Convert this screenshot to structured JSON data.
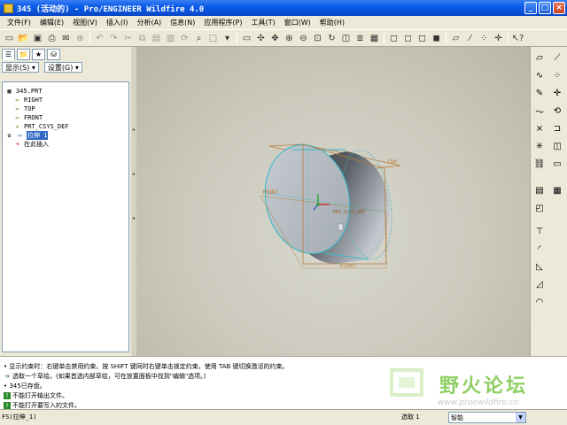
{
  "window": {
    "title": "345 (活动的) - Pro/ENGINEER Wildfire 4.0",
    "minimize": "_",
    "maximize": "□",
    "close": "×"
  },
  "menu": [
    "文件(F)",
    "编辑(E)",
    "视图(V)",
    "插入(I)",
    "分析(A)",
    "信息(N)",
    "应用程序(P)",
    "工具(T)",
    "窗口(W)",
    "帮助(H)"
  ],
  "left_panel": {
    "show_dropdown": "显示(S) ▾",
    "settings_dropdown": "设置(G) ▾",
    "tree": [
      {
        "label": "345.PRT",
        "icon": "part-icon"
      },
      {
        "label": "RIGHT",
        "icon": "datum-plane-icon"
      },
      {
        "label": "TOP",
        "icon": "datum-plane-icon"
      },
      {
        "label": "FRONT",
        "icon": "datum-plane-icon"
      },
      {
        "label": "PRT_CSYS_DEF",
        "icon": "csys-icon"
      },
      {
        "label": "拉伸 1",
        "icon": "extrude-icon",
        "selected": true
      },
      {
        "label": "在此插入",
        "icon": "insert-here-icon"
      }
    ]
  },
  "viewport": {
    "labels": {
      "top": "TOP",
      "front": "FRONT",
      "right": "RIGHT",
      "csys": "PRT_CSYS_DEF"
    },
    "colors": {
      "edge": "#2fb8c8",
      "datum": "#b57a3a",
      "body_dark": "#3a3d42",
      "body_light": "#aeb4bb"
    }
  },
  "messages": [
    {
      "icon": "bullet",
      "text": "• 显示约束时：右键单击禁用约束。按 SHIFT 键同时右键单击锁定约束。使用 TAB 键切换激活的约束。"
    },
    {
      "icon": "arrow",
      "text": "选取一个草绘。(如果首选内部草绘，可在放置面板中找到\"编辑\"选项。)"
    },
    {
      "icon": "bullet",
      "text": "• 345已存盘。"
    },
    {
      "icon": "warn",
      "text": "不能打开输出文件。"
    },
    {
      "icon": "warn",
      "text": "不能打开要写入的文件。"
    }
  ],
  "watermark": {
    "title": "野火论坛",
    "url": "www.proewildfire.cn"
  },
  "status": {
    "left": "FS(拉伸_1)",
    "filter_label": "选取 1",
    "filter_value": "智能"
  }
}
